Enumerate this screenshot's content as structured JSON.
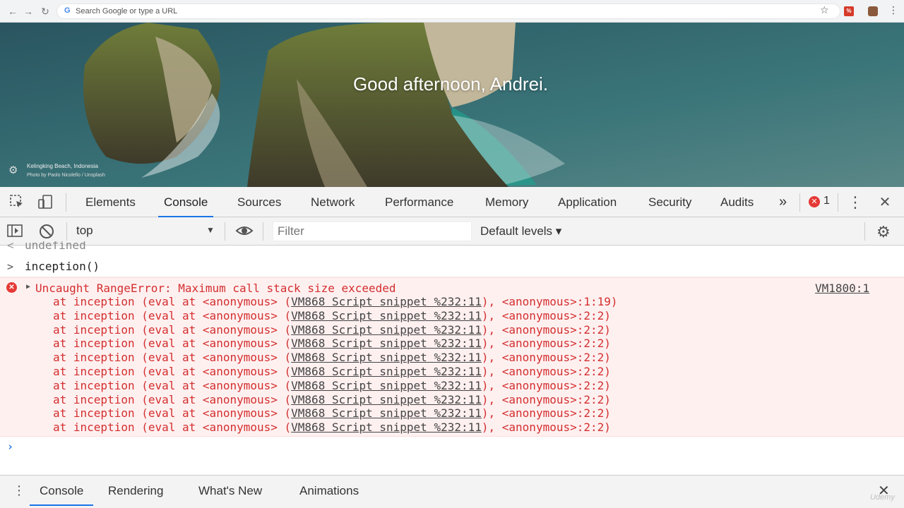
{
  "browser": {
    "back": "←",
    "forward": "→",
    "reload": "↻",
    "omnibox_placeholder": "Search Google or type a URL",
    "google_letter": "G",
    "star": "☆",
    "ext_label": "%",
    "menu": "⋮"
  },
  "new_tab": {
    "greeting": "Good afternoon, Andrei.",
    "photo_location": "Kelingking Beach, Indonesia",
    "photo_credit": "Photo by Paolo Nicolello / Unsplash"
  },
  "devtools": {
    "tabs": [
      "Elements",
      "Console",
      "Sources",
      "Network",
      "Performance",
      "Memory",
      "Application",
      "Security",
      "Audits"
    ],
    "active_tab": "Console",
    "more": "»",
    "error_count": "1",
    "close": "✕",
    "menu": "⋮"
  },
  "console_toolbar": {
    "context": "top",
    "filter_placeholder": "Filter",
    "levels": "Default levels ▾"
  },
  "console": {
    "previous_result": "undefined",
    "input": "inception()",
    "error": {
      "message": "Uncaught RangeError: Maximum call stack size exceeded",
      "source": "VM1800:1",
      "frames": [
        {
          "prefix": "at inception (eval at <anonymous> (",
          "link": "VM868 Script snippet %232:11",
          "suffix": "), <anonymous>:1:19)"
        },
        {
          "prefix": "at inception (eval at <anonymous> (",
          "link": "VM868 Script snippet %232:11",
          "suffix": "), <anonymous>:2:2)"
        },
        {
          "prefix": "at inception (eval at <anonymous> (",
          "link": "VM868 Script snippet %232:11",
          "suffix": "), <anonymous>:2:2)"
        },
        {
          "prefix": "at inception (eval at <anonymous> (",
          "link": "VM868 Script snippet %232:11",
          "suffix": "), <anonymous>:2:2)"
        },
        {
          "prefix": "at inception (eval at <anonymous> (",
          "link": "VM868 Script snippet %232:11",
          "suffix": "), <anonymous>:2:2)"
        },
        {
          "prefix": "at inception (eval at <anonymous> (",
          "link": "VM868 Script snippet %232:11",
          "suffix": "), <anonymous>:2:2)"
        },
        {
          "prefix": "at inception (eval at <anonymous> (",
          "link": "VM868 Script snippet %232:11",
          "suffix": "), <anonymous>:2:2)"
        },
        {
          "prefix": "at inception (eval at <anonymous> (",
          "link": "VM868 Script snippet %232:11",
          "suffix": "), <anonymous>:2:2)"
        },
        {
          "prefix": "at inception (eval at <anonymous> (",
          "link": "VM868 Script snippet %232:11",
          "suffix": "), <anonymous>:2:2)"
        },
        {
          "prefix": "at inception (eval at <anonymous> (",
          "link": "VM868 Script snippet %232:11",
          "suffix": "), <anonymous>:2:2)"
        }
      ]
    }
  },
  "drawer": {
    "tabs": [
      "Console",
      "Rendering",
      "What's New",
      "Animations"
    ],
    "active_tab": "Console",
    "close": "✕"
  },
  "watermark": "Udemy"
}
